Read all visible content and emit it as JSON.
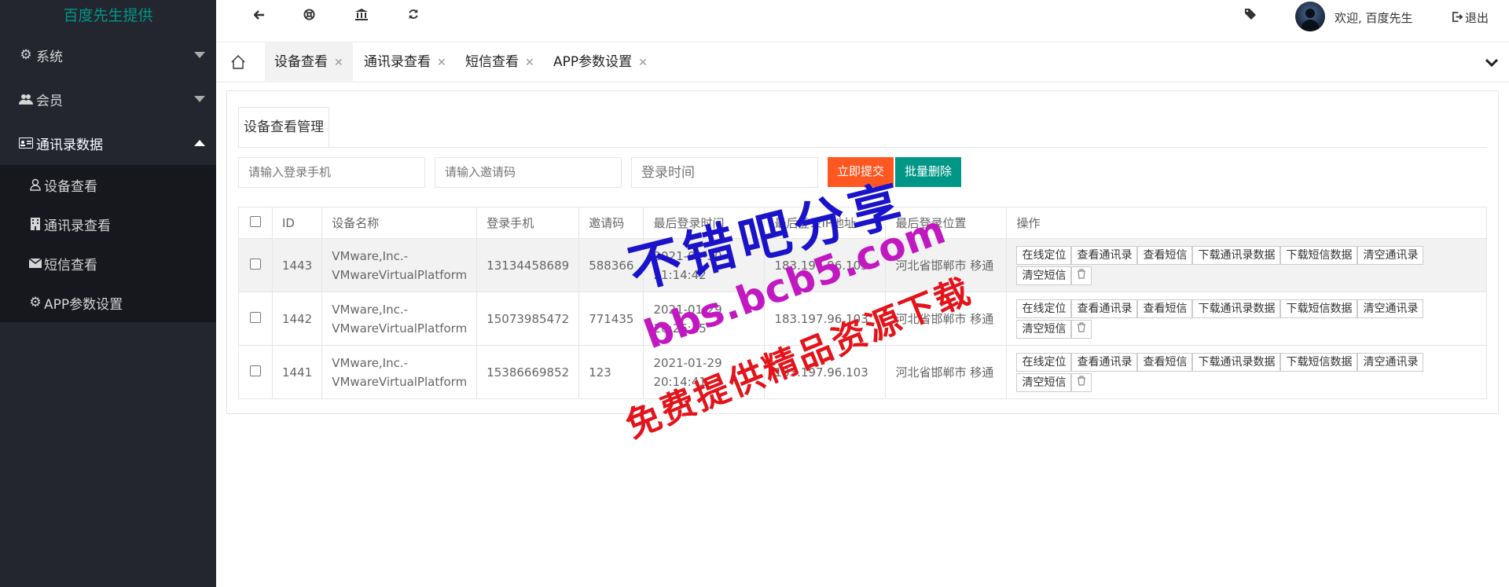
{
  "app": {
    "logo": "百度先生提供"
  },
  "sidebar": {
    "items": [
      {
        "label": "系统",
        "icon": "gear-icon"
      },
      {
        "label": "会员",
        "icon": "users-icon"
      },
      {
        "label": "通讯录数据",
        "icon": "id-card-icon"
      }
    ],
    "subitems": [
      {
        "label": "设备查看",
        "icon": "user-icon"
      },
      {
        "label": "通讯录查看",
        "icon": "building-icon"
      },
      {
        "label": "短信查看",
        "icon": "envelope-icon"
      },
      {
        "label": "APP参数设置",
        "icon": "gear-icon"
      }
    ]
  },
  "header": {
    "welcome": "欢迎, 百度先生",
    "logout": "退出"
  },
  "tabs": [
    {
      "label": "设备查看"
    },
    {
      "label": "通讯录查看"
    },
    {
      "label": "短信查看"
    },
    {
      "label": "APP参数设置"
    }
  ],
  "card": {
    "title": "设备查看管理"
  },
  "filters": {
    "phone_placeholder": "请输入登录手机",
    "invite_placeholder": "请输入邀请码",
    "time_placeholder": "登录时间",
    "submit": "立即提交",
    "batch_delete": "批量删除"
  },
  "colors": {
    "submit": "#ff5722",
    "delete": "#009688",
    "sidebar": "#23262e",
    "accent": "#009688"
  },
  "table": {
    "headers": [
      "ID",
      "设备名称",
      "登录手机",
      "邀请码",
      "最后登录时间",
      "最后登录IP地址",
      "最后登录位置",
      "操作"
    ],
    "ops": [
      "在线定位",
      "查看通讯录",
      "查看短信",
      "下载通讯录数据",
      "下载短信数据",
      "清空通讯录",
      "清空短信"
    ],
    "rows": [
      {
        "id": "1443",
        "name1": "VMware,Inc.-",
        "name2": "VMwareVirtualPlatform",
        "phone": "13134458689",
        "code": "588366",
        "time1": "2021-01-30",
        "time2": "21:14:42",
        "ip": "183.197.96.103",
        "loc": "河北省邯郸市 移通"
      },
      {
        "id": "1442",
        "name1": "VMware,Inc.-",
        "name2": "VMwareVirtualPlatform",
        "phone": "15073985472",
        "code": "771435",
        "time1": "2021-01-29",
        "time2": "20:26:15",
        "ip": "183.197.96.103",
        "loc": "河北省邯郸市 移通"
      },
      {
        "id": "1441",
        "name1": "VMware,Inc.-",
        "name2": "VMwareVirtualPlatform",
        "phone": "15386669852",
        "code": "123",
        "time1": "2021-01-29",
        "time2": "20:14:41",
        "ip": "183.197.96.103",
        "loc": "河北省邯郸市 移通"
      }
    ]
  },
  "watermark": {
    "line1": "不错吧分享",
    "line2": "bbs.bcb5.com",
    "line3": "免费提供精品资源下载"
  }
}
